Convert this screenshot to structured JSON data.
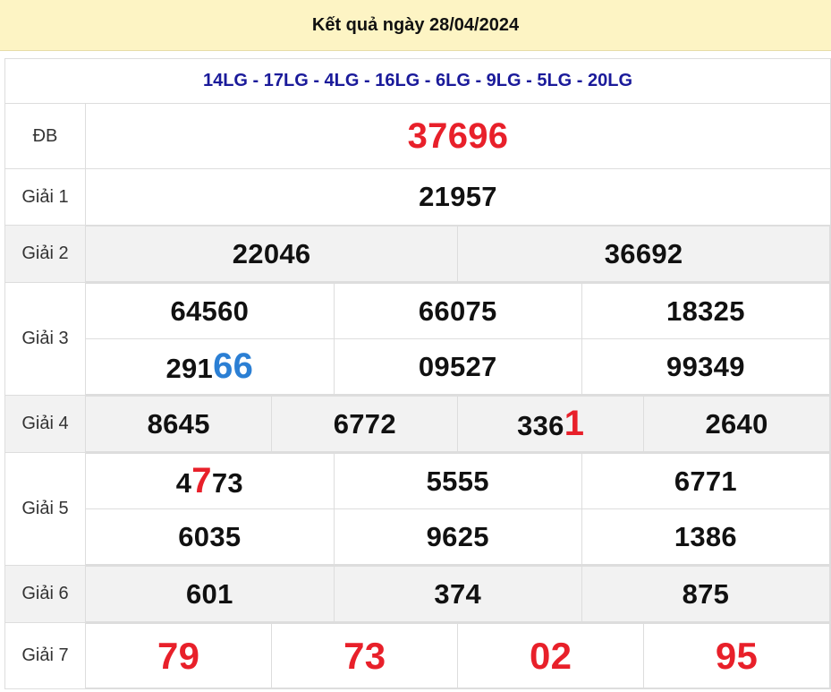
{
  "header": {
    "title": "Kết quả ngày 28/04/2024"
  },
  "codes": "14LG - 17LG - 4LG - 16LG - 6LG - 9LG - 5LG - 20LG",
  "prizes": {
    "db": {
      "label": "ĐB",
      "value": "37696"
    },
    "g1": {
      "label": "Giải 1",
      "value": "21957"
    },
    "g2": {
      "label": "Giải 2",
      "values": [
        "22046",
        "36692"
      ]
    },
    "g3": {
      "label": "Giải 3",
      "values": [
        "64560",
        "66075",
        "18325",
        "29166",
        "09527",
        "99349"
      ],
      "v4_plain": "291",
      "v4_highlight": "66"
    },
    "g4": {
      "label": "Giải 4",
      "values": [
        "8645",
        "6772",
        "3361",
        "2640"
      ],
      "v3_plain": "336",
      "v3_highlight": "1"
    },
    "g5": {
      "label": "Giải 5",
      "values": [
        "4773",
        "5555",
        "6771",
        "6035",
        "9625",
        "1386"
      ],
      "v1_pre": "4",
      "v1_highlight": "7",
      "v1_post": "73"
    },
    "g6": {
      "label": "Giải 6",
      "values": [
        "601",
        "374",
        "875"
      ]
    },
    "g7": {
      "label": "Giải 7",
      "values": [
        "79",
        "73",
        "02",
        "95"
      ]
    }
  },
  "colors": {
    "header_bg": "#fdf4c4",
    "red": "#e8202a",
    "blue": "#2b7fd4",
    "codes": "#1a1a9a",
    "row_alt": "#f2f2f2"
  }
}
